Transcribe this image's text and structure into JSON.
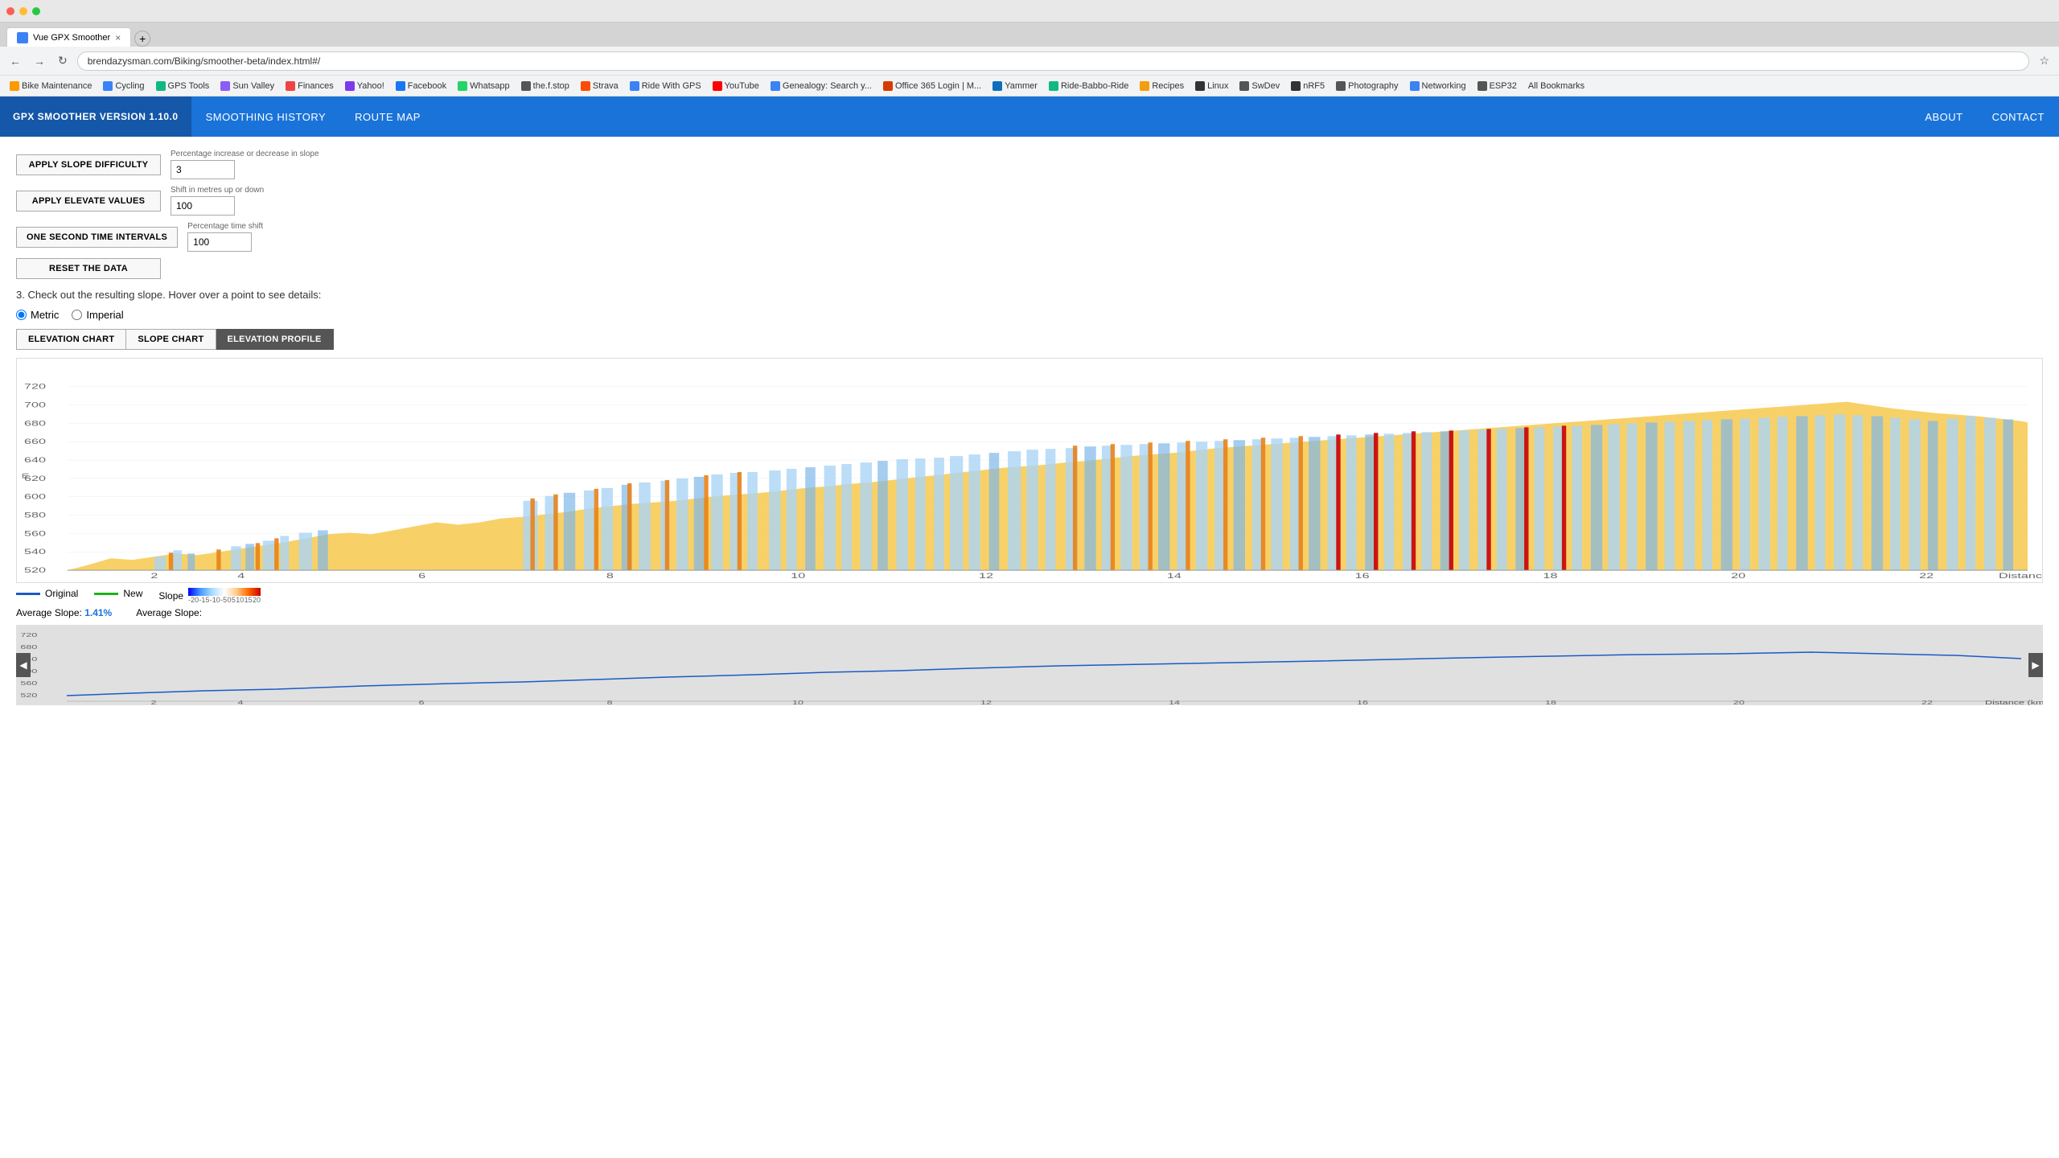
{
  "browser": {
    "tab_title": "Vue GPX Smoother",
    "url": "brendazysman.com/Biking/smoother-beta/index.html#/",
    "bookmarks": [
      {
        "label": "Bike Maintenance",
        "color": "#ff9900"
      },
      {
        "label": "Cycling",
        "color": "#3b82f6"
      },
      {
        "label": "GPS Tools",
        "color": "#10b981"
      },
      {
        "label": "Sun Valley",
        "color": "#8b5cf6"
      },
      {
        "label": "Finances",
        "color": "#ef4444"
      },
      {
        "label": "Yahoo!",
        "color": "#7c3aed"
      },
      {
        "label": "Facebook",
        "color": "#1877f2"
      },
      {
        "label": "Whatsapp",
        "color": "#25d366"
      },
      {
        "label": "the.f.stop",
        "color": "#555"
      },
      {
        "label": "Strava",
        "color": "#fc4c02"
      },
      {
        "label": "Ride With GPS",
        "color": "#3b82f6"
      },
      {
        "label": "YouTube",
        "color": "#ff0000"
      },
      {
        "label": "Genealogy: Search y...",
        "color": "#3b82f6"
      },
      {
        "label": "Office 365 Login | M...",
        "color": "#d83b01"
      },
      {
        "label": "Yammer",
        "color": "#106ebe"
      },
      {
        "label": "Ride-Babbo-Ride",
        "color": "#10b981"
      },
      {
        "label": "Recipes",
        "color": "#f59e0b"
      },
      {
        "label": "Linux",
        "color": "#333"
      },
      {
        "label": "SwDev",
        "color": "#555"
      },
      {
        "label": "nRF5",
        "color": "#333"
      },
      {
        "label": "Photography",
        "color": "#555"
      },
      {
        "label": "Networking",
        "color": "#3b82f6"
      },
      {
        "label": "ESP32",
        "color": "#555"
      },
      {
        "label": "All Bookmarks",
        "color": "#555"
      }
    ]
  },
  "nav": {
    "brand": "GPX SMOOTHER VERSION 1.10.0",
    "links": [
      {
        "label": "SMOOTHING HISTORY",
        "active": false
      },
      {
        "label": "ROUTE MAP",
        "active": false
      }
    ],
    "right_links": [
      {
        "label": "ABOUT"
      },
      {
        "label": "CONTACT"
      }
    ]
  },
  "controls": {
    "apply_slope_btn": "APPLY SLOPE DIFFICULTY",
    "apply_slope_label": "Percentage increase or decrease in slope",
    "apply_slope_value": "3",
    "apply_elevate_btn": "APPLY ELEVATE VALUES",
    "apply_elevate_label": "Shift in metres up or down",
    "apply_elevate_value": "100",
    "one_second_btn": "ONE SECOND TIME INTERVALS",
    "one_second_label": "Percentage time shift",
    "one_second_value": "100",
    "reset_btn": "RESET THE DATA"
  },
  "step3_text": "3. Check out the resulting slope. Hover over a point to see details:",
  "radio": {
    "metric": "Metric",
    "imperial": "Imperial",
    "selected": "metric"
  },
  "chart_tabs": [
    {
      "label": "ELEVATION CHART",
      "active": false
    },
    {
      "label": "SLOPE CHART",
      "active": false
    },
    {
      "label": "ELEVATION PROFILE",
      "active": true
    }
  ],
  "legend": {
    "original_label": "Original",
    "new_label": "New",
    "slope_label": "Slope",
    "slope_min": "-20",
    "slope_mid_labels": [
      "-15",
      "-10",
      "-5",
      "0",
      "5",
      "10",
      "15",
      "20"
    ],
    "slope_max": "20"
  },
  "avg_slope": {
    "original_label": "Average Slope:",
    "original_value": "1.41%",
    "new_label": "Average Slope:"
  },
  "x_axis": {
    "labels": [
      "2",
      "4",
      "6",
      "8",
      "10",
      "12",
      "14",
      "16",
      "18",
      "20",
      "22"
    ],
    "unit": "Distance (km)"
  },
  "y_axis": {
    "labels": [
      "520",
      "540",
      "560",
      "580",
      "600",
      "620",
      "640",
      "660",
      "680",
      "700",
      "720"
    ],
    "unit": "m"
  }
}
